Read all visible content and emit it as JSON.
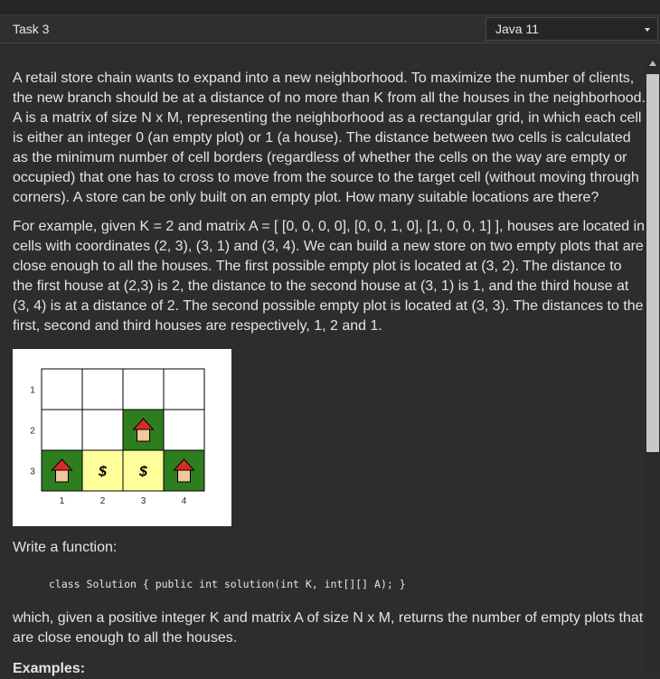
{
  "header": {
    "task_title": "Task 3",
    "language": "Java 11"
  },
  "description": {
    "p1": "A retail store chain wants to expand into a new neighborhood. To maximize the number of clients, the new branch should be at a distance of no more than K from all the houses in the neighborhood. A is a matrix of size N x M, representing the neighborhood as a rectangular grid, in which each cell is either an integer 0 (an empty plot) or 1 (a house). The distance between two cells is calculated as the minimum number of cell borders (regardless of whether the cells on the way are empty or occupied) that one has to cross to move from the source to the target cell (without moving through corners). A store can be only built on an empty plot. How many suitable locations are there?",
    "p2": "For example, given K = 2 and matrix A = [ [0, 0, 0, 0], [0, 0, 1, 0], [1, 0, 0, 1] ], houses are located in cells with coordinates (2, 3), (3, 1) and (3, 4). We can build a new store on two empty plots that are close enough to all the houses. The first possible empty plot is located at (3, 2). The distance to the first house at (2,3) is 2, the distance to the second house at (3, 1) is 1, and the third house at (3, 4) is at a distance of 2. The second possible empty plot is located at (3, 3). The distances to the first, second and third houses are respectively, 1, 2 and 1.",
    "write_function": "Write a function:",
    "signature": "class Solution { public int solution(int K, int[][] A); }",
    "which": "which, given a positive integer K and matrix A of size N x M, returns the number of empty plots that are close enough to all the houses.",
    "examples_heading": "Examples:"
  },
  "figure": {
    "row_labels": [
      "1",
      "2",
      "3"
    ],
    "col_labels": [
      "1",
      "2",
      "3",
      "4"
    ],
    "grid": [
      [
        "empty",
        "empty",
        "empty",
        "empty"
      ],
      [
        "empty",
        "empty",
        "house",
        "empty"
      ],
      [
        "house",
        "store",
        "store",
        "house"
      ]
    ],
    "store_symbol": "$",
    "colors": {
      "house_cell": "#2e7d1f",
      "store_cell": "#ffff99",
      "roof": "#d62b2b",
      "house_body": "#f2c79b"
    }
  }
}
